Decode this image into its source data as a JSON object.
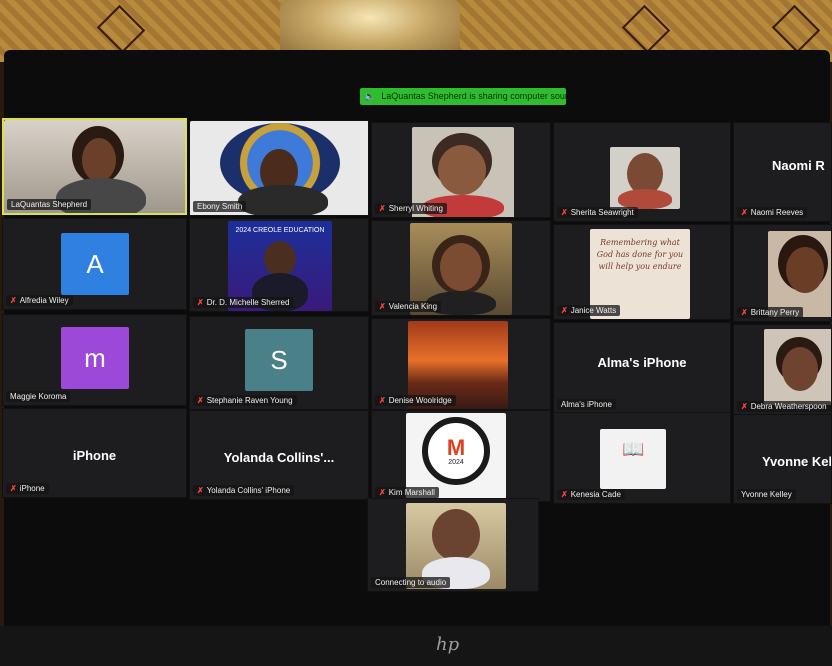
{
  "banner": {
    "text": "LaQuantas Shepherd is sharing computer sound"
  },
  "tiles": [
    {
      "name": "LaQuantas Shepherd",
      "muted": false
    },
    {
      "name": "Ebony Smith",
      "muted": false
    },
    {
      "name": "Sherryl Whiting",
      "muted": true
    },
    {
      "name": "Sherita Seawright",
      "muted": true
    },
    {
      "name": "Naomi Reeves",
      "big": "Naomi R",
      "muted": true
    },
    {
      "name": "Alfredia Wiley",
      "letter": "A",
      "muted": true
    },
    {
      "name": "Dr. D. Michelle Sherred",
      "muted": true,
      "caption": "2024 CREOLE EDUCATION"
    },
    {
      "name": "Valencia King",
      "muted": true
    },
    {
      "name": "Janice Watts",
      "muted": true,
      "card": "Remembering what God has done for you will help you endure"
    },
    {
      "name": "Brittany Perry",
      "muted": true
    },
    {
      "name": "Maggie Koroma",
      "letter": "m",
      "muted": false
    },
    {
      "name": "Stephanie Raven Young",
      "letter": "S",
      "muted": true
    },
    {
      "name": "Denise Woolridge",
      "muted": true
    },
    {
      "name": "Alma's iPhone",
      "big": "Alma's iPhone",
      "muted": false
    },
    {
      "name": "Debra Weatherspoon",
      "muted": true
    },
    {
      "name": "iPhone",
      "big": "iPhone",
      "muted": true
    },
    {
      "name": "Yolanda Collins' iPhone",
      "big": "Yolanda  Collins'...",
      "muted": true
    },
    {
      "name": "Kim Marshall",
      "muted": true,
      "logo": "M",
      "logo_year": "2024"
    },
    {
      "name": "Kenesia Cade",
      "muted": true
    },
    {
      "name": "Yvonne Kelley",
      "big": "Yvonne Kel",
      "muted": false
    },
    {
      "name": "Connecting to audio",
      "muted": false
    }
  ],
  "hp": "hp",
  "colors": {
    "active_border": "#d8e24a",
    "mute": "#ff4242",
    "banner": "#2fbd2f"
  }
}
